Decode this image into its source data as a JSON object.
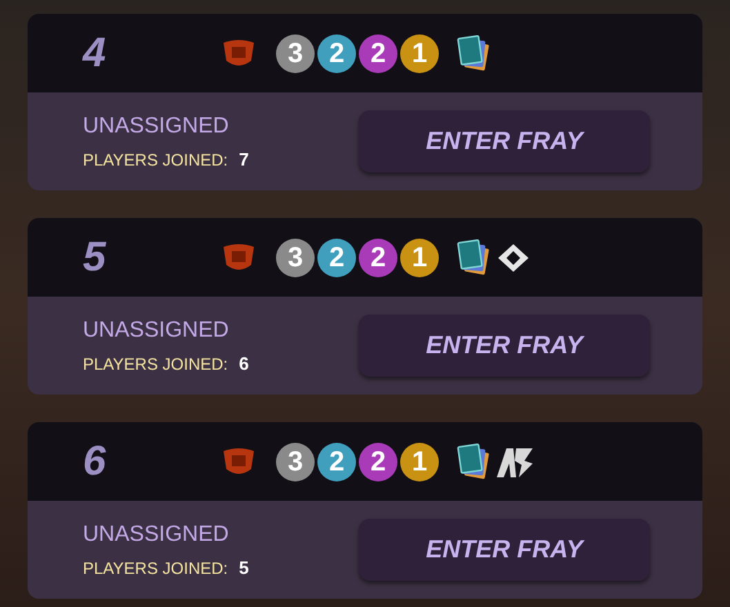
{
  "frays": [
    {
      "number": "4",
      "mana": [
        {
          "value": "3",
          "color": "#8a8a8a"
        },
        {
          "value": "2",
          "color": "#3f9fbd"
        },
        {
          "value": "2",
          "color": "#a93bb8"
        },
        {
          "value": "1",
          "color": "#c99212"
        }
      ],
      "extras": [
        {
          "kind": "cards"
        }
      ],
      "status": "UNASSIGNED",
      "players_label": "PLAYERS JOINED:",
      "players": "7",
      "button": "ENTER FRAY"
    },
    {
      "number": "5",
      "mana": [
        {
          "value": "3",
          "color": "#8a8a8a"
        },
        {
          "value": "2",
          "color": "#3f9fbd"
        },
        {
          "value": "2",
          "color": "#a93bb8"
        },
        {
          "value": "1",
          "color": "#c99212"
        }
      ],
      "extras": [
        {
          "kind": "cards"
        },
        {
          "kind": "diamond"
        }
      ],
      "status": "UNASSIGNED",
      "players_label": "PLAYERS JOINED:",
      "players": "6",
      "button": "ENTER FRAY"
    },
    {
      "number": "6",
      "mana": [
        {
          "value": "3",
          "color": "#8a8a8a"
        },
        {
          "value": "2",
          "color": "#3f9fbd"
        },
        {
          "value": "2",
          "color": "#a93bb8"
        },
        {
          "value": "1",
          "color": "#c99212"
        }
      ],
      "extras": [
        {
          "kind": "cards"
        },
        {
          "kind": "logo"
        }
      ],
      "status": "UNASSIGNED",
      "players_label": "PLAYERS JOINED:",
      "players": "5",
      "button": "ENTER FRAY"
    }
  ]
}
